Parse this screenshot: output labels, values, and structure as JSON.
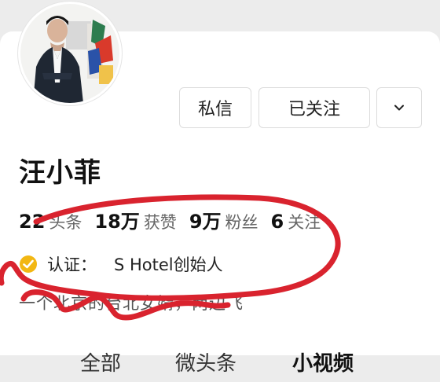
{
  "profile": {
    "name": "汪小菲",
    "avatar_icon": "profile-photo"
  },
  "actions": {
    "message_label": "私信",
    "follow_label": "已关注",
    "more_icon": "chevron-down-icon"
  },
  "stats": [
    {
      "value": "22",
      "label": "头条"
    },
    {
      "value": "18万",
      "label": "获赞"
    },
    {
      "value": "9万",
      "label": "粉丝"
    },
    {
      "value": "6",
      "label": "关注"
    }
  ],
  "verification": {
    "badge_icon": "verified-badge-icon",
    "label": "认证：",
    "text": "S Hotel创始人"
  },
  "bio": "一个北京的台北女婿，两边飞",
  "tabs": [
    {
      "label": "全部"
    },
    {
      "label": "微头条"
    },
    {
      "label": "小视频",
      "active": true
    }
  ],
  "colors": {
    "annotation_red": "#d9232e",
    "badge_gold": "#f2b713"
  }
}
